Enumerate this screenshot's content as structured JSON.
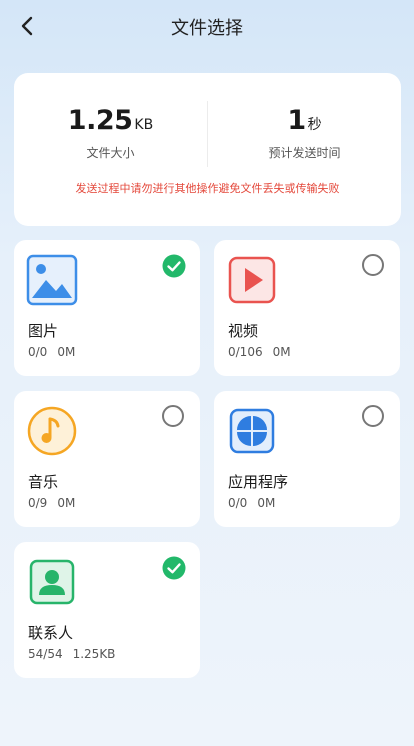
{
  "header": {
    "title": "文件选择",
    "back_icon": "chevron-left-icon"
  },
  "stats": {
    "size_value": "1.25",
    "size_unit": "KB",
    "size_label": "文件大小",
    "time_value": "1",
    "time_unit": "秒",
    "time_label": "预计发送时间",
    "warning": "发送过程中请勿进行其他操作避免文件丢失或传输失败"
  },
  "categories": [
    {
      "name": "图片",
      "count": "0/0",
      "size": "0M",
      "icon": "image-icon",
      "selected": true
    },
    {
      "name": "视频",
      "count": "0/106",
      "size": "0M",
      "icon": "video-icon",
      "selected": false
    },
    {
      "name": "音乐",
      "count": "0/9",
      "size": "0M",
      "icon": "music-icon",
      "selected": false
    },
    {
      "name": "应用程序",
      "count": "0/0",
      "size": "0M",
      "icon": "apps-icon",
      "selected": false
    },
    {
      "name": "联系人",
      "count": "54/54",
      "size": "1.25KB",
      "icon": "contact-icon",
      "selected": true
    }
  ],
  "colors": {
    "check_green": "#22b86a",
    "warning_red": "#e4493c",
    "image_blue": "#3d8ee8",
    "video_red": "#e9534f",
    "music_orange": "#f5a623",
    "apps_blue": "#2f7de0",
    "contact_green": "#27b46a"
  }
}
